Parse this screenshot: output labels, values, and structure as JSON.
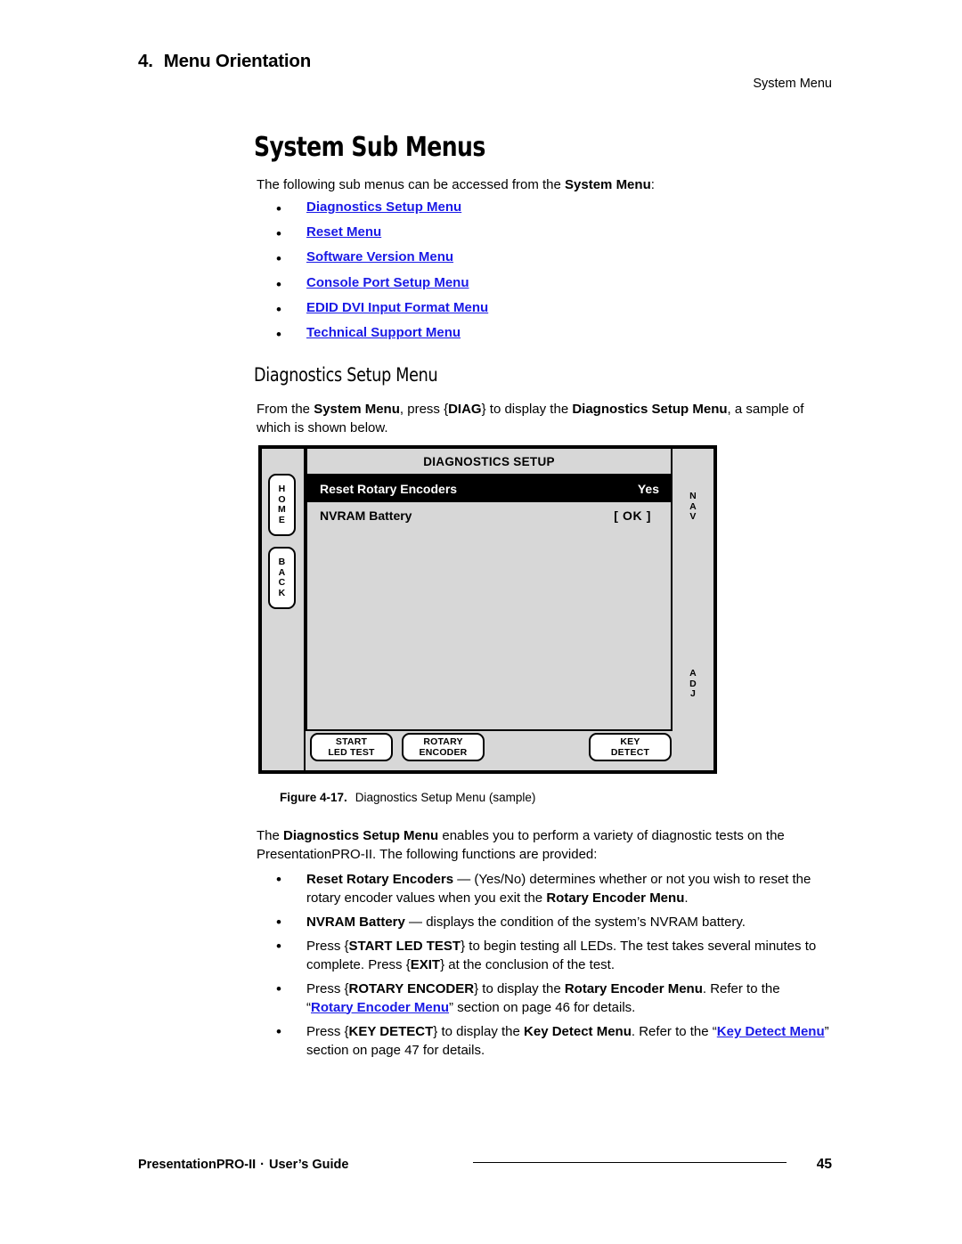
{
  "header": {
    "chapter_number": "4.",
    "chapter_title": "Menu Orientation",
    "running_head": "System Menu"
  },
  "section": {
    "title": "System Sub Menus",
    "intro_prefix": "The following sub menus can be accessed from the ",
    "intro_bold": "System Menu",
    "intro_suffix": ":",
    "links": [
      {
        "label": "Diagnostics Setup Menu"
      },
      {
        "label": "Reset Menu"
      },
      {
        "label": "Software Version Menu"
      },
      {
        "label": "Console Port Setup Menu"
      },
      {
        "label": "EDID DVI Input Format Menu"
      },
      {
        "label": "Technical Support Menu"
      }
    ]
  },
  "subsection": {
    "title": "Diagnostics Setup Menu",
    "paragraph": {
      "p1": "From the ",
      "b1": "System Menu",
      "p2": ", press {",
      "b2": "DIAG",
      "p3": "} to display the ",
      "b3": "Diagnostics Setup Menu",
      "p4": ", a sample of which is shown below."
    }
  },
  "figure": {
    "screen_title": "DIAGNOSTICS SETUP",
    "left_keys": [
      {
        "name": "HOME",
        "letters": [
          "H",
          "O",
          "M",
          "E"
        ]
      },
      {
        "name": "BACK",
        "letters": [
          "B",
          "A",
          "C",
          "K"
        ]
      }
    ],
    "right_labels": [
      {
        "name": "NAV",
        "letters": [
          "N",
          "A",
          "V"
        ]
      },
      {
        "name": "ADJ",
        "letters": [
          "A",
          "D",
          "J"
        ]
      }
    ],
    "menu_rows": [
      {
        "label": "Reset Rotary Encoders",
        "value": "Yes",
        "highlighted": true
      },
      {
        "label": "NVRAM Battery",
        "value": "[ OK ]",
        "highlighted": false
      }
    ],
    "buttons": [
      {
        "line1": "START",
        "line2": "LED TEST"
      },
      {
        "line1": "ROTARY",
        "line2": "ENCODER"
      },
      {
        "line1": "KEY",
        "line2": "DETECT"
      }
    ],
    "caption_label": "Figure 4-17.",
    "caption_text": "Diagnostics Setup Menu  (sample)"
  },
  "description": {
    "p1": "The ",
    "b1": "Diagnostics Setup Menu",
    "p2": " enables you to perform a variety of diagnostic tests on the PresentationPRO-II.  The following functions are provided:"
  },
  "function_bullets_1": [
    {
      "b1": "Reset Rotary Encoders",
      "t1": " — (Yes/No) determines whether or not you wish to reset the rotary encoder values when you exit the ",
      "b2": "Rotary Encoder Menu",
      "t2": "."
    },
    {
      "b1": "NVRAM Battery",
      "t1": " — displays the condition of the system’s NVRAM battery.",
      "b2": "",
      "t2": ""
    }
  ],
  "function_bullets_2": [
    {
      "t1": "Press {",
      "b1": "START LED TEST",
      "t2": "} to begin testing all LEDs.  The test takes several minutes to complete.  Press {",
      "b2": "EXIT",
      "t3": "} at the conclusion of the test.",
      "link": "",
      "t4": ""
    },
    {
      "t1": "Press {",
      "b1": "ROTARY ENCODER",
      "t2": "} to display the ",
      "b2": "Rotary Encoder Menu",
      "t3": ".  Refer to the “",
      "link": "Rotary Encoder Menu",
      "t4": "” section on page 46 for details."
    },
    {
      "t1": "Press {",
      "b1": "KEY DETECT",
      "t2": "} to display the ",
      "b2": "Key Detect Menu",
      "t3": ".  Refer to the “",
      "link": "Key Detect Menu",
      "t4": "” section on page 47 for details."
    }
  ],
  "footer": {
    "product": "PresentationPRO-II",
    "separator": "·",
    "doc_type": "User’s Guide",
    "page_number": "45"
  },
  "colors": {
    "link": "#1919e6",
    "panel_bg": "#d7d7d7",
    "highlight_bg": "#000000",
    "text": "#000000"
  }
}
